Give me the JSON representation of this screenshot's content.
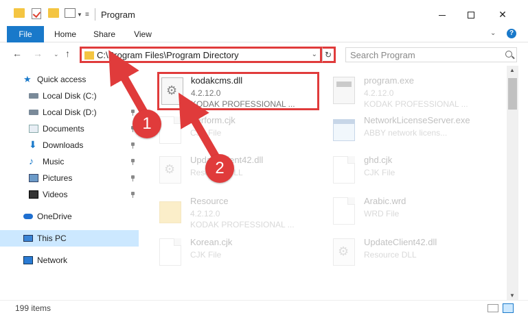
{
  "window": {
    "title": "Program",
    "minimize": "—",
    "maximize": "□",
    "close": "✕"
  },
  "ribbon": {
    "tabs": [
      "File",
      "Home",
      "Share",
      "View"
    ],
    "expand": "⌄",
    "help": "?"
  },
  "nav": {
    "back": "←",
    "forward": "→",
    "recent": "⌄",
    "up": "↑",
    "address": "C:\\Program Files\\Program Directory",
    "address_dropdown": "⌄",
    "refresh": "↻",
    "search_placeholder": "Search Program"
  },
  "sidebar": {
    "items": [
      {
        "label": "Quick access",
        "icon": "star-icon"
      },
      {
        "label": "Local Disk (C:)",
        "icon": "disk-icon",
        "pinned": true
      },
      {
        "label": "Local Disk (D:)",
        "icon": "disk-icon",
        "pinned": true
      },
      {
        "label": "Documents",
        "icon": "documents-icon",
        "pinned": true
      },
      {
        "label": "Downloads",
        "icon": "download-icon",
        "pinned": true
      },
      {
        "label": "Music",
        "icon": "music-icon",
        "pinned": true
      },
      {
        "label": "Pictures",
        "icon": "pictures-icon",
        "pinned": true
      },
      {
        "label": "Videos",
        "icon": "videos-icon",
        "pinned": true
      },
      {
        "label": "OneDrive",
        "icon": "cloud-icon"
      },
      {
        "label": "This PC",
        "icon": "computer-icon",
        "selected": true
      },
      {
        "label": "Network",
        "icon": "network-icon"
      }
    ]
  },
  "files": [
    {
      "name": "kodakcms.dll",
      "sub1": "4.2.12.0",
      "sub2": "KODAK PROFESSIONAL ...",
      "icon": "dll-icon",
      "selected": true
    },
    {
      "name": "program.exe",
      "sub1": "4.2.12.0",
      "sub2": "KODAK PROFESSIONAL ...",
      "icon": "exe-icon"
    },
    {
      "name": "Perform.cjk",
      "sub1": "CJK File",
      "sub2": "",
      "icon": "document-icon"
    },
    {
      "name": "NetworkLicenseServer.exe",
      "sub1": "ABBY network licens...",
      "sub2": "",
      "icon": "window-icon"
    },
    {
      "name": "UpdateClient42.dll",
      "sub1": "Resource DLL",
      "sub2": "",
      "icon": "dll-icon"
    },
    {
      "name": "ghd.cjk",
      "sub1": "CJK File",
      "sub2": "",
      "icon": "document-icon"
    },
    {
      "name": "Resource",
      "sub1": "4.2.12.0",
      "sub2": "KODAK PROFESSIONAL ...",
      "icon": "folder-icon"
    },
    {
      "name": "Arabic.wrd",
      "sub1": "WRD File",
      "sub2": "",
      "icon": "document-icon"
    },
    {
      "name": "Korean.cjk",
      "sub1": "CJK File",
      "sub2": "",
      "icon": "document-icon"
    },
    {
      "name": "UpdateClient42.dll",
      "sub1": "Resource DLL",
      "sub2": "",
      "icon": "dll-icon"
    }
  ],
  "status": {
    "items": "199 items"
  },
  "annotations": {
    "step1": "1",
    "step2": "2",
    "color": "#e03b3b"
  }
}
